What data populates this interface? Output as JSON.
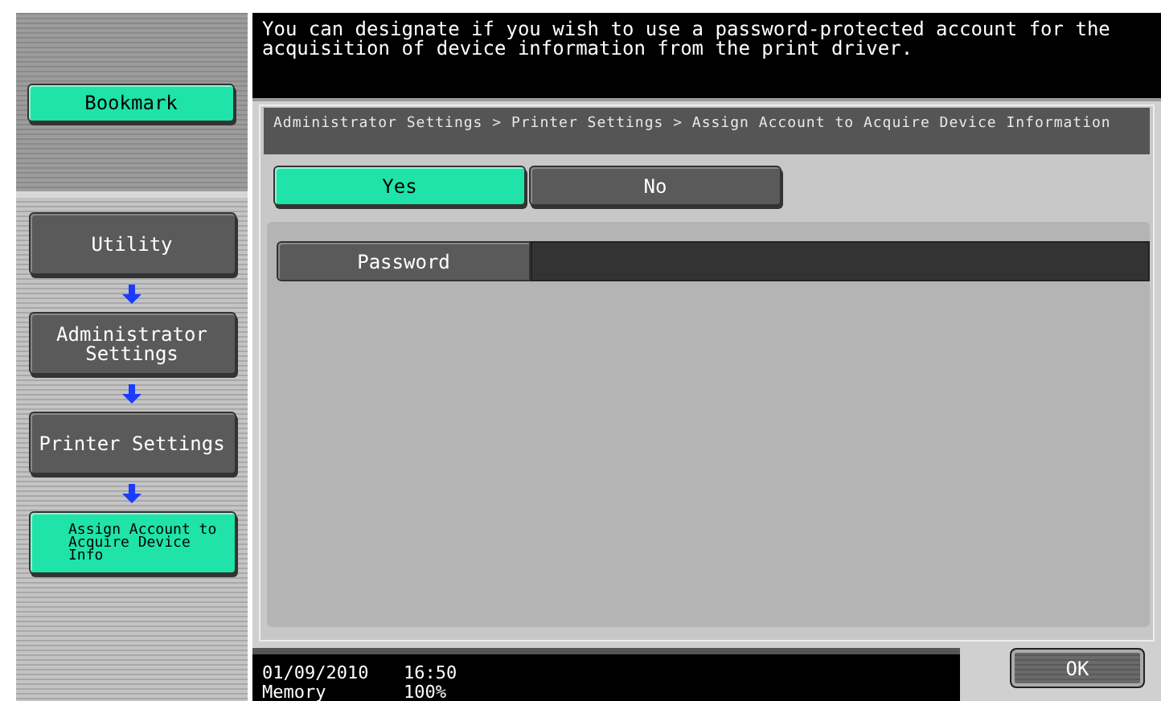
{
  "sidebar": {
    "bookmark": "Bookmark",
    "nav": [
      {
        "label": "Utility",
        "selected": false
      },
      {
        "label": "Administrator Settings",
        "selected": false
      },
      {
        "label": "Printer Settings",
        "selected": false
      },
      {
        "label": "Assign Account to Acquire Device Info",
        "selected": true
      }
    ]
  },
  "message": "You can designate if you wish to use a password-protected account for the acquisition of device information from the print driver.",
  "breadcrumb": "Administrator Settings > Printer Settings > Assign Account to Acquire Device Information",
  "options": [
    {
      "label": "Yes",
      "selected": true
    },
    {
      "label": "No",
      "selected": false
    }
  ],
  "password": {
    "label": "Password"
  },
  "status": {
    "date": "01/09/2010",
    "time": "16:50",
    "memory_label": "Memory",
    "memory": "100%"
  },
  "ok_button": "OK"
}
